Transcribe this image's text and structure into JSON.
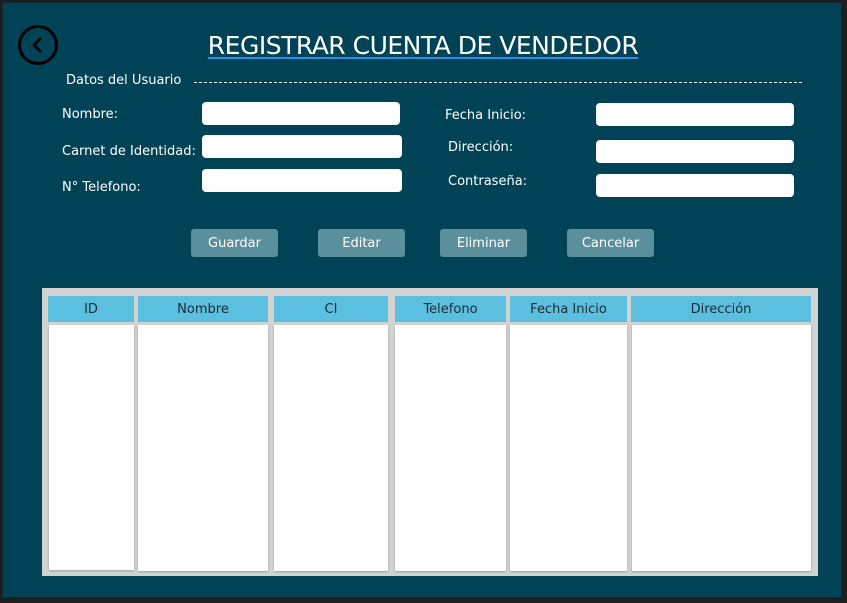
{
  "form": {
    "title": "REGISTRAR CUENTA DE VENDEDOR",
    "section_label": "Datos del Usuario",
    "fields": {
      "nombre": {
        "label": "Nombre:",
        "value": ""
      },
      "carnet": {
        "label": "Carnet de Identidad:",
        "value": ""
      },
      "telefono": {
        "label": "N° Telefono:",
        "value": ""
      },
      "fecha_inicio": {
        "label": "Fecha Inicio:",
        "value": ""
      },
      "direccion": {
        "label": "Dirección:",
        "value": ""
      },
      "contrasena": {
        "label": "Contraseña:",
        "value": ""
      }
    }
  },
  "actions": {
    "guardar": "Guardar",
    "editar": "Editar",
    "eliminar": "Eliminar",
    "cancelar": "Cancelar"
  },
  "table": {
    "columns": [
      "ID",
      "Nombre",
      "CI",
      "Telefono",
      "Fecha Inicio",
      "Dirección"
    ],
    "rows": []
  },
  "icons": {
    "back": "back-arrow-icon"
  },
  "colors": {
    "background": "#004356",
    "header_cell": "#5bc0e0",
    "button": "#5a8f9b",
    "title_underline": "#2f8fe8"
  }
}
